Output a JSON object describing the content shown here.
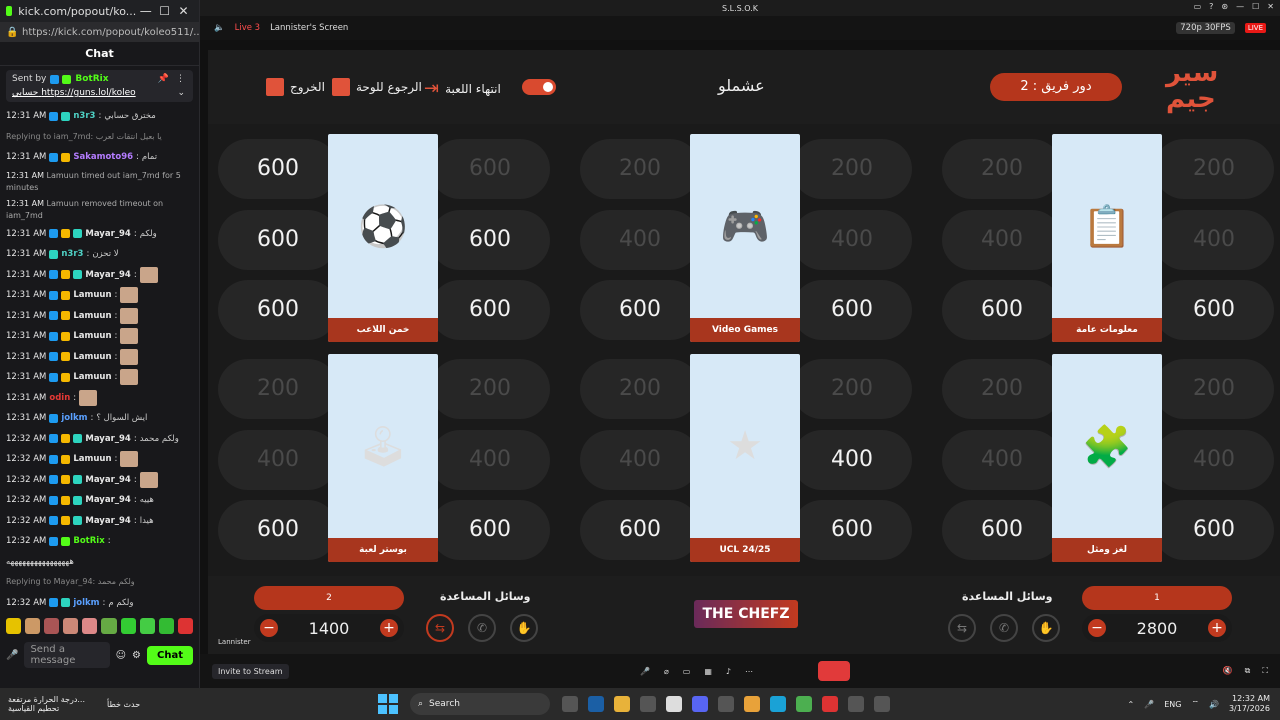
{
  "popup": {
    "title": "kick.com/popout/ko...",
    "url": "https://kick.com/popout/koleo511/...",
    "chat_title": "Chat"
  },
  "pinned": {
    "sent_by_label": "Sent by",
    "sender": "BotRix",
    "text": "حسابي",
    "link": "https://guns.lol/koleo"
  },
  "messages": [
    {
      "time": "12:31 AM",
      "user": "n3r3",
      "color": "#4fd1c5",
      "text": "مخترق حسابي",
      "badges": [
        "blue",
        "teal"
      ]
    },
    {
      "type": "reply",
      "text": "Replying to iam_7md: يا بعيل انتقات لعرب"
    },
    {
      "time": "12:31 AM",
      "user": "Sakamoto96",
      "color": "#b47cff",
      "text": "تمام",
      "badges": [
        "blue",
        "gold"
      ]
    },
    {
      "type": "system",
      "time": "12:31 AM",
      "text": "Lamuun timed out iam_7md for 5 minutes"
    },
    {
      "type": "system",
      "time": "12:31 AM",
      "text": "Lamuun removed timeout on iam_7md"
    },
    {
      "time": "12:31 AM",
      "user": "Mayar_94",
      "color": "#e8e8e8",
      "text": "ولكم",
      "badges": [
        "blue",
        "gold",
        "teal"
      ]
    },
    {
      "time": "12:31 AM",
      "user": "n3r3",
      "color": "#4fd1c5",
      "text": "لا تحزن",
      "badges": [
        "teal"
      ]
    },
    {
      "time": "12:31 AM",
      "user": "Mayar_94",
      "color": "#e8e8e8",
      "text": "",
      "emote": true,
      "badges": [
        "blue",
        "gold",
        "teal"
      ]
    },
    {
      "time": "12:31 AM",
      "user": "Lamuun",
      "color": "#e8e8e8",
      "text": "",
      "emote": true,
      "badges": [
        "blue",
        "gold"
      ]
    },
    {
      "time": "12:31 AM",
      "user": "Lamuun",
      "color": "#e8e8e8",
      "text": "",
      "emote": true,
      "badges": [
        "blue",
        "gold"
      ]
    },
    {
      "time": "12:31 AM",
      "user": "Lamuun",
      "color": "#e8e8e8",
      "text": "",
      "emote": true,
      "badges": [
        "blue",
        "gold"
      ]
    },
    {
      "time": "12:31 AM",
      "user": "Lamuun",
      "color": "#e8e8e8",
      "text": "",
      "emote": true,
      "badges": [
        "blue",
        "gold"
      ]
    },
    {
      "time": "12:31 AM",
      "user": "Lamuun",
      "color": "#e8e8e8",
      "text": "",
      "emote": true,
      "badges": [
        "blue",
        "gold"
      ]
    },
    {
      "time": "12:31 AM",
      "user": "odin",
      "color": "#e53935",
      "text": "",
      "emote": true,
      "badges": []
    },
    {
      "time": "12:31 AM",
      "user": "jolkm",
      "color": "#5aa0ff",
      "text": "ايش السوال ؟",
      "badges": [
        "blue"
      ]
    },
    {
      "time": "12:32 AM",
      "user": "Mayar_94",
      "color": "#e8e8e8",
      "text": "ولكم محمد",
      "badges": [
        "blue",
        "gold",
        "teal"
      ]
    },
    {
      "time": "12:32 AM",
      "user": "Lamuun",
      "color": "#e8e8e8",
      "text": "",
      "emote": true,
      "badges": [
        "blue",
        "gold"
      ]
    },
    {
      "time": "12:32 AM",
      "user": "Mayar_94",
      "color": "#e8e8e8",
      "text": "",
      "emote": true,
      "badges": [
        "blue",
        "gold",
        "teal"
      ]
    },
    {
      "time": "12:32 AM",
      "user": "Mayar_94",
      "color": "#e8e8e8",
      "text": "هييه",
      "badges": [
        "blue",
        "gold",
        "teal"
      ]
    },
    {
      "time": "12:32 AM",
      "user": "Mayar_94",
      "color": "#e8e8e8",
      "text": "هيدا",
      "badges": [
        "blue",
        "gold",
        "teal"
      ]
    },
    {
      "time": "12:32 AM",
      "user": "BotRix",
      "color": "#53fc18",
      "text": "",
      "badges": [
        "blue",
        "green"
      ]
    },
    {
      "type": "reply",
      "text": "Replying to Mayar_94: ولكم محمد"
    },
    {
      "time": "12:32 AM",
      "user": "jolkm",
      "color": "#5aa0ff",
      "text": "ولكم م",
      "badges": [
        "blue",
        "teal"
      ]
    }
  ],
  "botrix_line": "ههههههههههههههههه",
  "chat_input": {
    "placeholder": "Send a message",
    "button": "Chat"
  },
  "top_toolbar": {
    "title": "S.L.S.O.K"
  },
  "stream_bar": {
    "live": "Live 3",
    "screen": "Lannister's Screen",
    "quality": "720p 30FPS",
    "live_badge": "LIVE"
  },
  "game": {
    "exit": "الخروج",
    "back_to_board": "الرجوع للوحة",
    "end_game": "انتهاء اللعبة",
    "game_name": "عشملو",
    "turn": "دور فريق : 2",
    "logo_line1": "سير",
    "logo_line2": "جيم"
  },
  "categories": [
    {
      "label": "خمن اللاعب",
      "icon": "⚽",
      "left": [
        "600",
        "600",
        "600"
      ],
      "right": [
        "600",
        "600",
        "600"
      ],
      "left_used": [
        false,
        false,
        false
      ],
      "right_used": [
        true,
        false,
        false
      ]
    },
    {
      "label": "Video Games",
      "icon": "🎮",
      "left": [
        "200",
        "400",
        "600"
      ],
      "right": [
        "200",
        "400",
        "600"
      ],
      "left_used": [
        true,
        true,
        false
      ],
      "right_used": [
        true,
        true,
        false
      ]
    },
    {
      "label": "معلومات عامة",
      "icon": "📋",
      "left": [
        "200",
        "400",
        "600"
      ],
      "right": [
        "200",
        "400",
        "600"
      ],
      "left_used": [
        true,
        true,
        false
      ],
      "right_used": [
        true,
        true,
        false
      ]
    },
    {
      "label": "بوستر لعبة",
      "icon": "🕹",
      "left": [
        "200",
        "400",
        "600"
      ],
      "right": [
        "200",
        "400",
        "600"
      ],
      "left_used": [
        true,
        true,
        false
      ],
      "right_used": [
        true,
        true,
        false
      ]
    },
    {
      "label": "UCL 24/25",
      "icon": "★",
      "left": [
        "200",
        "400",
        "600"
      ],
      "right": [
        "200",
        "400",
        "600"
      ],
      "left_used": [
        true,
        true,
        false
      ],
      "right_used": [
        true,
        false,
        false
      ]
    },
    {
      "label": "لغز ومثل",
      "icon": "🧩",
      "left": [
        "200",
        "400",
        "600"
      ],
      "right": [
        "200",
        "400",
        "600"
      ],
      "left_used": [
        true,
        true,
        false
      ],
      "right_used": [
        true,
        true,
        false
      ]
    }
  ],
  "team_left": {
    "name": "2",
    "score": "1400",
    "minus": "−",
    "plus": "+"
  },
  "team_right": {
    "name": "1",
    "score": "2800",
    "minus": "−",
    "plus": "+"
  },
  "help_label": "وسائل المساعدة",
  "sponsor": "THE CHEFZ",
  "stream_footer": {
    "user": "Lannister",
    "invite": "Invite to Stream"
  },
  "taskbar": {
    "weather_line1": "درجة الحرارة مرتفعة...",
    "weather_line2": "تحطيم القياسية",
    "news": "حدث خطأ",
    "search": "Search",
    "lang": "ENG",
    "time": "12:32 AM",
    "date": "3/17/2026"
  }
}
